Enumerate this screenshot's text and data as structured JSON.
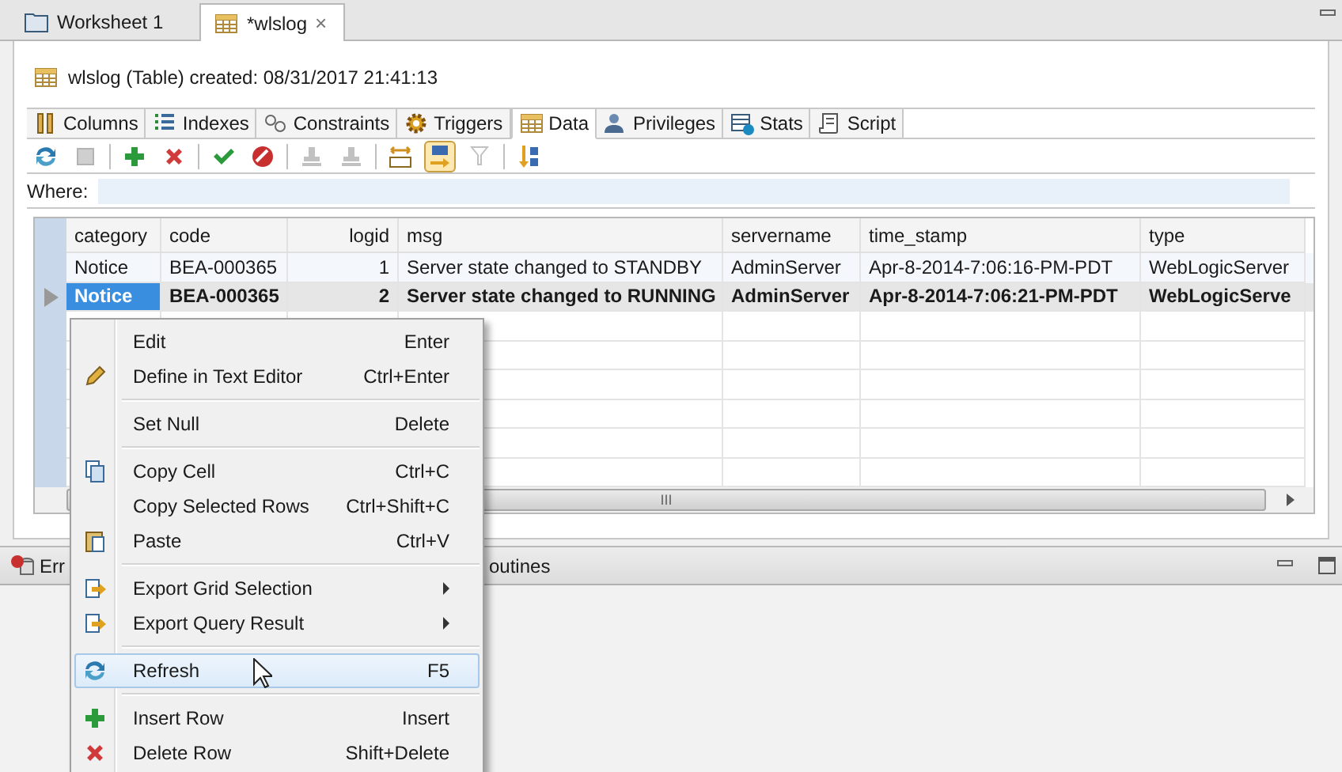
{
  "editor_tabs": [
    {
      "label": "Worksheet 1",
      "selected": false
    },
    {
      "label": "*wlslog",
      "selected": true,
      "close": "×"
    }
  ],
  "header": {
    "title": "wlslog (Table) created: 08/31/2017 21:41:13"
  },
  "sub_tabs": [
    {
      "label": "Columns",
      "selected": false
    },
    {
      "label": "Indexes",
      "selected": false
    },
    {
      "label": "Constraints",
      "selected": false
    },
    {
      "label": "Triggers",
      "selected": false
    },
    {
      "label": "Data",
      "selected": true
    },
    {
      "label": "Privileges",
      "selected": false
    },
    {
      "label": "Stats",
      "selected": false
    },
    {
      "label": "Script",
      "selected": false
    }
  ],
  "toolbar": [
    {
      "kind": "button",
      "disabled": false,
      "pressed": false
    },
    {
      "kind": "button",
      "disabled": true,
      "pressed": false
    },
    {
      "kind": "separator"
    },
    {
      "kind": "button",
      "disabled": false,
      "pressed": false
    },
    {
      "kind": "button",
      "disabled": false,
      "pressed": false
    },
    {
      "kind": "separator"
    },
    {
      "kind": "button",
      "disabled": false,
      "pressed": false
    },
    {
      "kind": "button",
      "disabled": false,
      "pressed": false
    },
    {
      "kind": "separator"
    },
    {
      "kind": "button",
      "disabled": true,
      "pressed": false
    },
    {
      "kind": "button",
      "disabled": true,
      "pressed": false
    },
    {
      "kind": "separator"
    },
    {
      "kind": "button",
      "disabled": false,
      "pressed": false
    },
    {
      "kind": "button",
      "disabled": false,
      "pressed": true
    },
    {
      "kind": "button",
      "disabled": true,
      "pressed": false
    },
    {
      "kind": "separator"
    },
    {
      "kind": "button",
      "disabled": false,
      "pressed": false
    }
  ],
  "where": {
    "label": "Where:"
  },
  "grid": {
    "columns": [
      "category",
      "code",
      "logid",
      "msg",
      "servername",
      "time_stamp",
      "type"
    ],
    "rows": [
      {
        "selected": false,
        "cells": [
          {
            "text": "Notice",
            "selected": false
          },
          {
            "text": "BEA-000365",
            "selected": false
          },
          {
            "text": "1",
            "selected": false
          },
          {
            "text": "Server state changed to STANDBY",
            "selected": false
          },
          {
            "text": "AdminServer",
            "selected": false
          },
          {
            "text": "Apr-8-2014-7:06:16-PM-PDT",
            "selected": false
          },
          {
            "text": "WebLogicServer",
            "selected": false
          }
        ]
      },
      {
        "selected": true,
        "cells": [
          {
            "text": "Notice",
            "selected": true
          },
          {
            "text": "BEA-000365",
            "selected": false
          },
          {
            "text": "2",
            "selected": false
          },
          {
            "text": "Server state changed to RUNNING",
            "selected": false
          },
          {
            "text": "AdminServer",
            "selected": false
          },
          {
            "text": "Apr-8-2014-7:06:21-PM-PDT",
            "selected": false
          },
          {
            "text": "WebLogicServe",
            "selected": false
          }
        ]
      }
    ],
    "scroll_grip": "III"
  },
  "bottom_tabs": [
    "Err",
    "outines"
  ],
  "context_menu": [
    {
      "kind": "item",
      "label": "Edit",
      "shortcut": "Enter",
      "highlighted": false
    },
    {
      "kind": "item",
      "label": "Define in Text Editor",
      "shortcut": "Ctrl+Enter",
      "highlighted": false
    },
    {
      "kind": "separator"
    },
    {
      "kind": "item",
      "label": "Set Null",
      "shortcut": "Delete",
      "highlighted": false
    },
    {
      "kind": "separator"
    },
    {
      "kind": "item",
      "label": "Copy Cell",
      "shortcut": "Ctrl+C",
      "highlighted": false
    },
    {
      "kind": "item",
      "label": "Copy Selected Rows",
      "shortcut": "Ctrl+Shift+C",
      "highlighted": false
    },
    {
      "kind": "item",
      "label": "Paste",
      "shortcut": "Ctrl+V",
      "highlighted": false
    },
    {
      "kind": "separator"
    },
    {
      "kind": "submenu",
      "label": "Export Grid Selection",
      "highlighted": false
    },
    {
      "kind": "submenu",
      "label": "Export Query Result",
      "highlighted": false
    },
    {
      "kind": "separator"
    },
    {
      "kind": "item",
      "label": "Refresh",
      "shortcut": "F5",
      "highlighted": true
    },
    {
      "kind": "separator"
    },
    {
      "kind": "item",
      "label": "Insert Row",
      "shortcut": "Insert",
      "highlighted": false
    },
    {
      "kind": "item",
      "label": "Delete Row",
      "shortcut": "Shift+Delete",
      "highlighted": false
    }
  ]
}
